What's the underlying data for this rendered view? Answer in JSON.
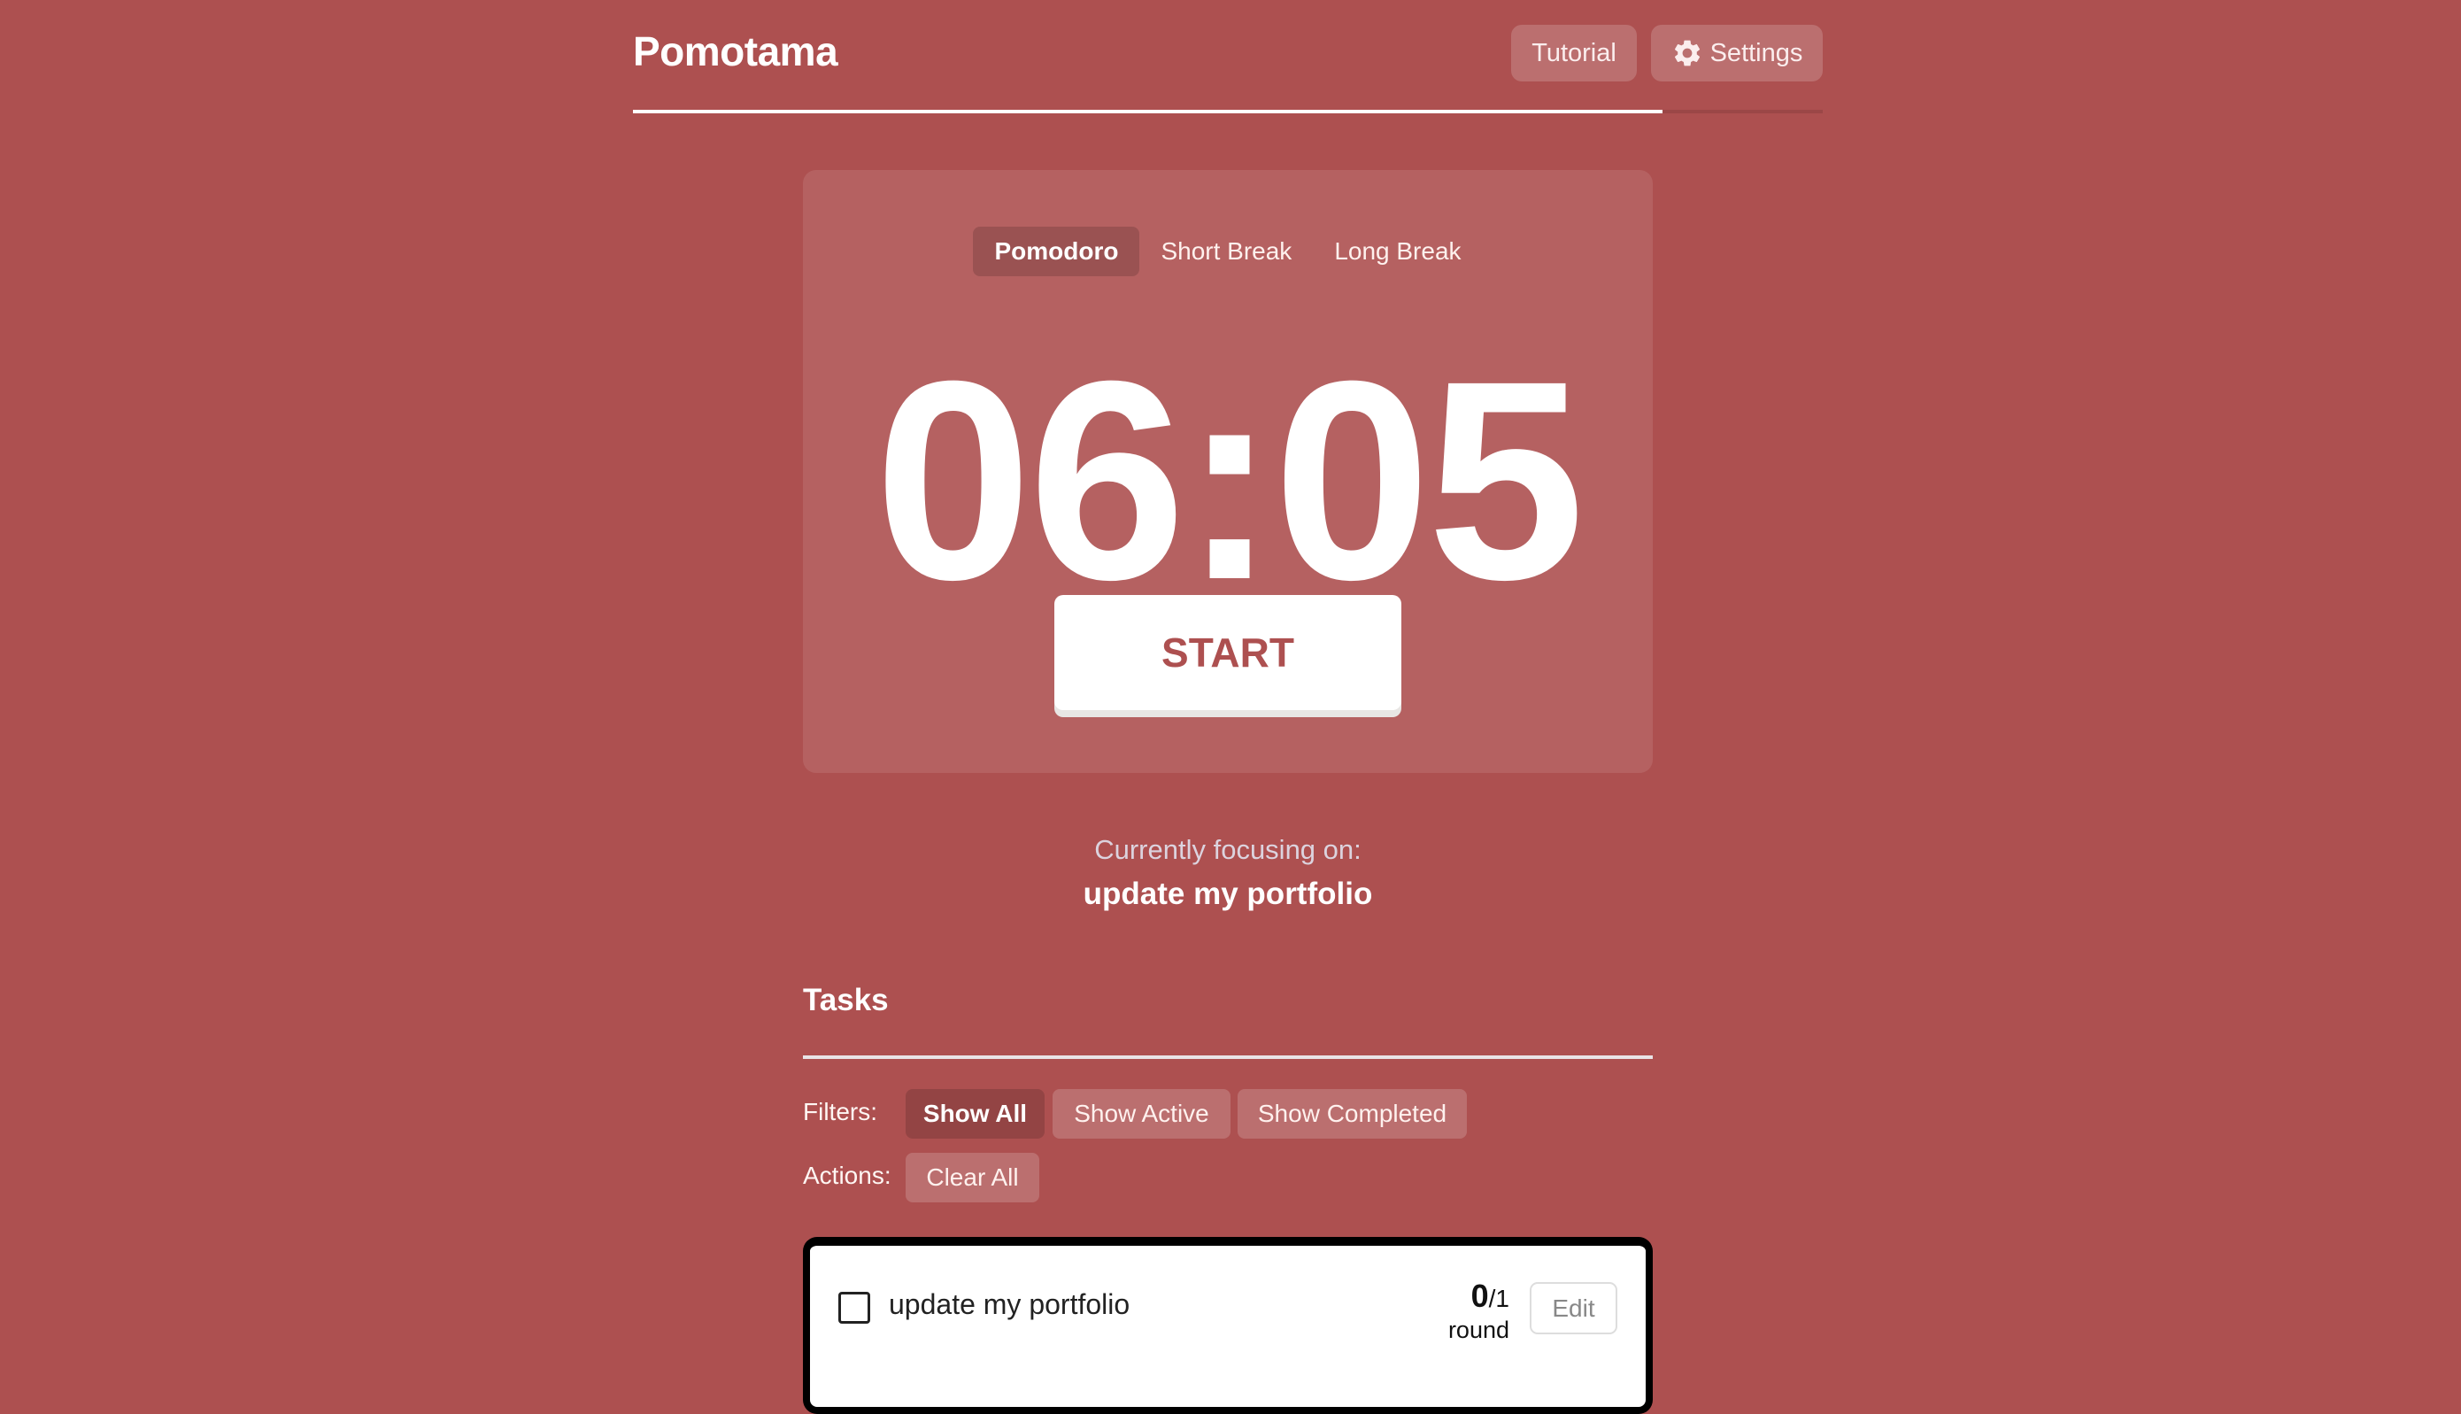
{
  "header": {
    "title": "Pomotama",
    "tutorial_label": "Tutorial",
    "settings_label": "Settings",
    "settings_icon": "gear-icon",
    "progress_fraction": 0.865
  },
  "timer": {
    "modes": [
      {
        "label": "Pomodoro",
        "active": true
      },
      {
        "label": "Short Break",
        "active": false
      },
      {
        "label": "Long Break",
        "active": false
      }
    ],
    "time": "06:05",
    "start_label": "START"
  },
  "focus": {
    "label": "Currently focusing on:",
    "task": "update my portfolio"
  },
  "tasks": {
    "heading": "Tasks",
    "filters_label": "Filters:",
    "filters": [
      {
        "label": "Show All",
        "active": true
      },
      {
        "label": "Show Active",
        "active": false
      },
      {
        "label": "Show Completed",
        "active": false
      }
    ],
    "actions_label": "Actions:",
    "actions": [
      {
        "label": "Clear All"
      }
    ],
    "items": [
      {
        "text": "update my portfolio",
        "completed": false,
        "rounds_done": "0",
        "rounds_total": "/1",
        "rounds_unit": "round",
        "edit_label": "Edit"
      }
    ]
  },
  "colors": {
    "background": "#ad5050",
    "accent_text": "#ad5050",
    "active_pill": "rgba(0,0,0,0.15)",
    "task_border": "#000000"
  }
}
